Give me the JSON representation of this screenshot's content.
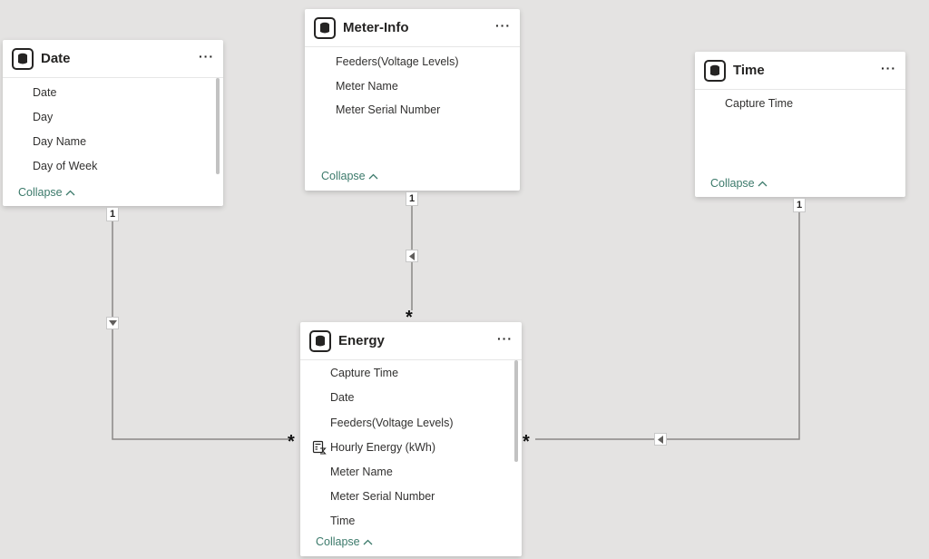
{
  "tables": {
    "date": {
      "title": "Date",
      "fields": [
        "Date",
        "Day",
        "Day Name",
        "Day of Week"
      ],
      "collapse": "Collapse"
    },
    "meter_info": {
      "title": "Meter-Info",
      "fields": [
        "Feeders(Voltage Levels)",
        "Meter Name",
        "Meter Serial Number"
      ],
      "collapse": "Collapse"
    },
    "time": {
      "title": "Time",
      "fields": [
        "Capture Time"
      ],
      "collapse": "Collapse"
    },
    "energy": {
      "title": "Energy",
      "fields": [
        "Capture Time",
        "Date",
        "Feeders(Voltage Levels)",
        "Hourly Energy (kWh)",
        "Meter Name",
        "Meter Serial Number",
        "Time"
      ],
      "collapse": "Collapse"
    }
  },
  "more_menu_glyph": "···",
  "relationships": {
    "one": "1",
    "many": "*"
  },
  "icons": {
    "table": "table-cylinder-icon",
    "more": "more-options-icon",
    "measure": "measure-calculator-icon",
    "collapse": "chevron-up-icon",
    "direction_left": "triangle-left-icon",
    "direction_down": "triangle-down-icon"
  },
  "colors": {
    "canvas": "#e4e3e2",
    "link": "#3c7a6b",
    "line": "#8a8886"
  }
}
